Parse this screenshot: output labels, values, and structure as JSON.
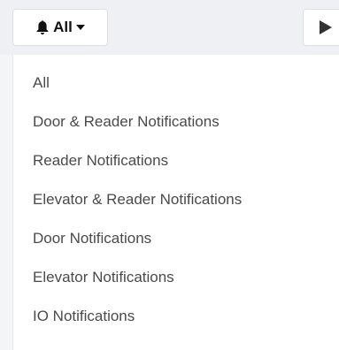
{
  "filter": {
    "selected": "All",
    "icon": "bell-icon",
    "caret_icon": "caret-down-icon"
  },
  "play": {
    "icon": "play-icon"
  },
  "menu": {
    "items": [
      {
        "label": "All"
      },
      {
        "label": "Door & Reader Notifications"
      },
      {
        "label": "Reader Notifications"
      },
      {
        "label": "Elevator & Reader Notifications"
      },
      {
        "label": "Door Notifications"
      },
      {
        "label": "Elevator Notifications"
      },
      {
        "label": "IO Notifications"
      }
    ]
  }
}
